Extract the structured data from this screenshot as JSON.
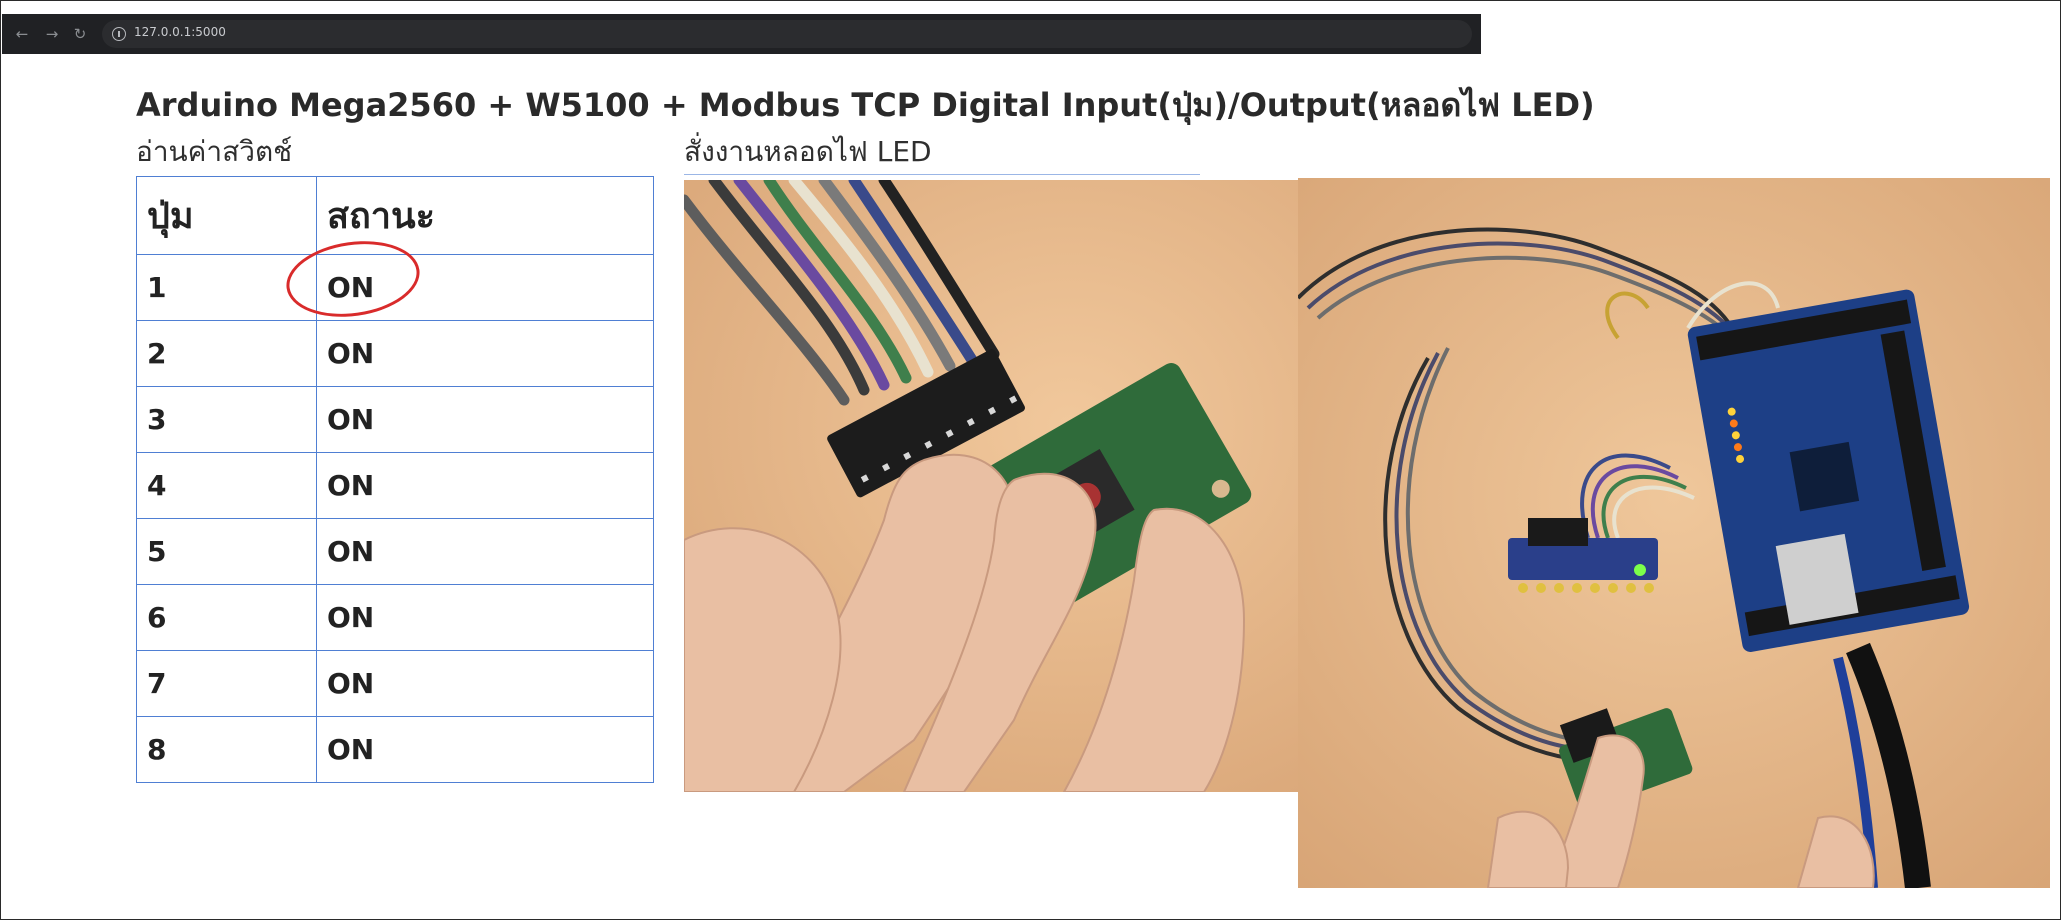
{
  "browser": {
    "back_icon": "arrow-left-icon",
    "forward_icon": "arrow-right-icon",
    "reload_icon": "reload-icon",
    "url": "127.0.0.1:5000"
  },
  "page": {
    "title": "Arduino Mega2560 + W5100 + Modbus TCP Digital Input(ปุ่ม)/Output(หลอดไฟ LED)",
    "read_section_label": "อ่านค่าสวิตช์",
    "led_section_label": "สั่งงานหลอดไฟ LED"
  },
  "switch_table": {
    "headers": [
      "ปุ่ม",
      "สถานะ"
    ],
    "rows": [
      [
        "1",
        "ON"
      ],
      [
        "2",
        "ON"
      ],
      [
        "3",
        "ON"
      ],
      [
        "4",
        "ON"
      ],
      [
        "5",
        "ON"
      ],
      [
        "6",
        "ON"
      ],
      [
        "7",
        "ON"
      ],
      [
        "8",
        "ON"
      ]
    ]
  },
  "colors": {
    "table_border": "#4f7fd3",
    "highlight_ring": "#d92b2b",
    "browser_bar": "#202124"
  }
}
